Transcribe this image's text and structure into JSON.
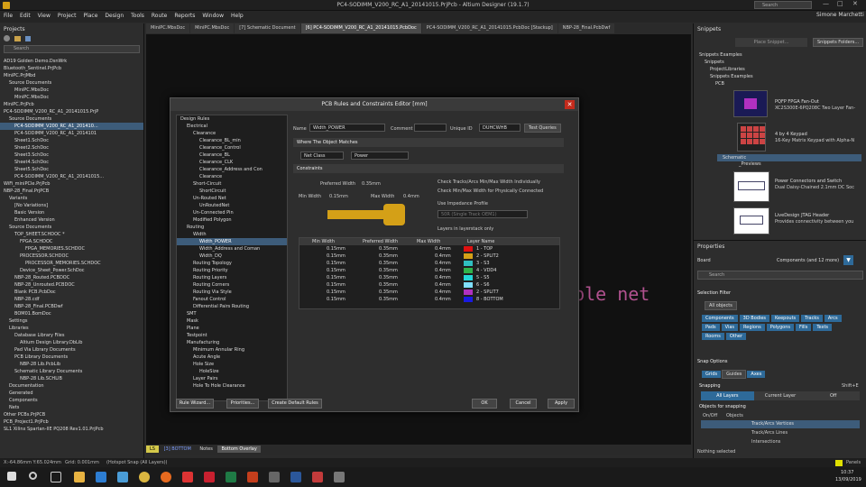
{
  "window": {
    "title": "PC4-SODIMM_V200_RC_A1_20141015.PrjPcb - Altium Designer (19.1.7)",
    "search": "Search",
    "user": "Simone Marchetti"
  },
  "menu": [
    "File",
    "Edit",
    "View",
    "Project",
    "Place",
    "Design",
    "Tools",
    "Route",
    "Reports",
    "Window",
    "Help"
  ],
  "tabs": [
    "MiniPC.MbsDoc",
    "MiniPC.MbsDoc",
    "[7] Schematic Document",
    "[6] PC4-SODIMM_V200_RC_A1_20141015.PcbDoc",
    "PC4-SODIMM_V200_RC_A1_20141015.PcbDoc [Stackup]",
    "NBP-28_Final.PcbDwf"
  ],
  "projects": {
    "title": "Projects",
    "search": "Search",
    "items": [
      "AD19 Golden Demo.DsnWrk",
      "Bluetooth_Sentinel.PrjPcb",
      "MiniPC.PrjMbd",
      "Source Documents",
      "MiniPC.MbsDoc",
      "MiniPC.MbsDoc",
      "MiniPC.PrjPcb",
      "PC4-SODIMM_V200_RC_A1_20141015.PrjP",
      "Source Documents",
      "PC4-SODIMM_V200_RC_A1_201410...",
      "PC4-SODIMM_V200_RC_A1_2014101",
      "Sheet1.SchDoc",
      "Sheet2.SchDoc",
      "Sheet3.SchDoc",
      "Sheet4.SchDoc",
      "Sheet5.SchDoc",
      "PC4-SODIMM_V200_RC_A1_20141015...",
      "WiFi_miniPCIe.PrjPcb",
      "NBP-28_Final.PrjPCB",
      "Variants",
      "[No Variations]",
      "Basic Version",
      "Enhanced Version",
      "Source Documents",
      "TOP_SHEET.SCHDOC *",
      "FPGA.SCHDOC",
      "FPGA_MEMORIES.SCHDOC",
      "PROCESSOR.SCHDOC",
      "PROCESSOR_MEMORIES.SCHDOC",
      "Device_Sheet_Power.SchDoc",
      "NBP-28_Routed.PCBDOC",
      "NBP-28_Unrouted.PCBDOC",
      "Blank PCB.PcbDoc",
      "NBP-28.cdf",
      "NBP-28_Final.PCBDwf",
      "BOM01.BomDoc",
      "Settings",
      "Libraries",
      "Database Library Files",
      "Altium Design Library.DbLib",
      "Pad Via Library Documents",
      "PCB Library Documents",
      "NBP-28 Lib.PcbLib",
      "Schematic Library Documents",
      "NBP-28 Lib.SCHLIB",
      "Documentation",
      "Generated",
      "Components",
      "Nets",
      "Other PCBs.PrjPCB",
      "PCB_Project1.PrjPcb",
      "SL1 Xilinx Spartan-IIE PQ208 Rev1.01.PrjPcb"
    ]
  },
  "snippets": {
    "title": "Snippets",
    "place": "Place Snippet...",
    "folders": "Snippets Folders...",
    "tree": [
      "Snippets Examples",
      "Snippets",
      "ProjectLibraries",
      "Snippets Examples",
      "PCB",
      "Schematic",
      "_Previews"
    ],
    "entries": [
      {
        "t1": "PQFP FPGA Fan-Out",
        "t2": "XC2S300E-6PQ208C Two Layer Fan-"
      },
      {
        "t1": "4 by 4 Keypad",
        "t2": "16-Key Matrix Keypad with Alpha-N"
      },
      {
        "t1": "Power Connectors and Switch",
        "t2": "Dual Daisy-Chained 2.1mm DC Soc"
      },
      {
        "t1": "LiveDesign JTAG Header",
        "t2": "Provides connectivity between you"
      }
    ]
  },
  "properties": {
    "title": "Properties",
    "board": "Board",
    "components": "Components (and 12 more)",
    "search": "Search",
    "selection_filter": "Selection Filter",
    "all_objects": "All objects",
    "filters": [
      "Components",
      "3D Bodies",
      "Keepouts",
      "Tracks",
      "Arcs",
      "Pads",
      "Vias",
      "Regions",
      "Polygons",
      "Fills",
      "Texts",
      "Rooms",
      "Other"
    ],
    "snap_options": "Snap Options",
    "snap_btns": [
      "Grids",
      "Guides",
      "Axes"
    ],
    "snapping": "Snapping",
    "shortcut": "Shift+E",
    "snap_layers": [
      "All Layers",
      "Current Layer",
      "Off"
    ],
    "objects_for_snapping": "Objects for snapping",
    "onoff": "On/Off",
    "objects": "Objects",
    "snap_objects": [
      "Track/Arcs Vertices",
      "Track/Arcs Lines",
      "Intersections"
    ],
    "nothing": "Nothing selected"
  },
  "layerbar": [
    "LS",
    "[3] BOTTOM",
    "Notes",
    "Bottom Overlay"
  ],
  "status": {
    "coords": "X:-64.86mm Y:65.024mm",
    "grid": "Grid: 0.001mm",
    "snap": "(Hotspot Snap (All Layers))",
    "panels": "Panels"
  },
  "clock": {
    "time": "10:37",
    "date": "13/09/2019"
  },
  "canvas_text": "able net",
  "dialog": {
    "title": "PCB Rules and Constraints Editor [mm]",
    "tree": [
      "Design Rules",
      "Electrical",
      "Clearance",
      "Clearance_BL_min",
      "Clearance_Control",
      "Clearance_BL",
      "Clearance_CLK",
      "Clearance_Address and Con",
      "Clearance",
      "Short-Circuit",
      "ShortCircuit",
      "Un-Routed Net",
      "UnRoutedNet",
      "Un-Connected Pin",
      "Modified Polygon",
      "Routing",
      "Width",
      "Width_POWER",
      "Width_Address and Coman",
      "Width_DQ",
      "Routing Topology",
      "Routing Priority",
      "Routing Layers",
      "Routing Corners",
      "Routing Via Style",
      "Fanout Control",
      "Differential Pairs Routing",
      "SMT",
      "Mask",
      "Plane",
      "Testpoint",
      "Manufacturing",
      "Minimum Annular Ring",
      "Acute Angle",
      "Hole Size",
      "HoleSize",
      "Layer Pairs",
      "Hole To Hole Clearance"
    ],
    "name_label": "Name",
    "name": "Width_POWER",
    "comment_label": "Comment",
    "uid_label": "Unique ID",
    "uid": "DUHCWHB",
    "test": "Test Queries",
    "where": "Where The Object Matches",
    "scope1": "Net Class",
    "scope2": "Power",
    "constraints": "Constraints",
    "pref_label": "Preferred Width",
    "pref": "0.35mm",
    "min_label": "Min Width",
    "min": "0.15mm",
    "max_label": "Max Width",
    "max": "0.4mm",
    "opt1": "Check Tracks/Arcs Min/Max Width Individually",
    "opt2": "Check Min/Max Width for Physically Connected",
    "opt3": "Use Impedance Profile",
    "opt3v": "50R (Single Track OEM1)",
    "opt4": "Layers in layerstack only",
    "cols": [
      "Min Width",
      "Preferred Width",
      "Max Width",
      "Layer Name"
    ],
    "rows": [
      {
        "min": "0.15mm",
        "pref": "0.35mm",
        "max": "0.4mm",
        "layer": "1 - TOP",
        "color": "#e01010"
      },
      {
        "min": "0.15mm",
        "pref": "0.35mm",
        "max": "0.4mm",
        "layer": "2 - SPLIT2",
        "color": "#d4a017"
      },
      {
        "min": "0.15mm",
        "pref": "0.35mm",
        "max": "0.4mm",
        "layer": "3 - S3",
        "color": "#30c0c0"
      },
      {
        "min": "0.15mm",
        "pref": "0.35mm",
        "max": "0.4mm",
        "layer": "4 - VDD4",
        "color": "#2fb34a"
      },
      {
        "min": "0.15mm",
        "pref": "0.35mm",
        "max": "0.4mm",
        "layer": "5 - S5",
        "color": "#24d6d6"
      },
      {
        "min": "0.15mm",
        "pref": "0.35mm",
        "max": "0.4mm",
        "layer": "6 - S6",
        "color": "#7fdfff"
      },
      {
        "min": "0.15mm",
        "pref": "0.35mm",
        "max": "0.4mm",
        "layer": "2 - SPLIT7",
        "color": "#b030c0"
      },
      {
        "min": "0.15mm",
        "pref": "0.35mm",
        "max": "0.4mm",
        "layer": "8 - BOTTOM",
        "color": "#1a1ae0"
      }
    ],
    "buttons": {
      "wizard": "Rule Wizard...",
      "priorities": "Priorities...",
      "defaults": "Create Default Rules",
      "ok": "OK",
      "cancel": "Cancel",
      "apply": "Apply"
    }
  }
}
